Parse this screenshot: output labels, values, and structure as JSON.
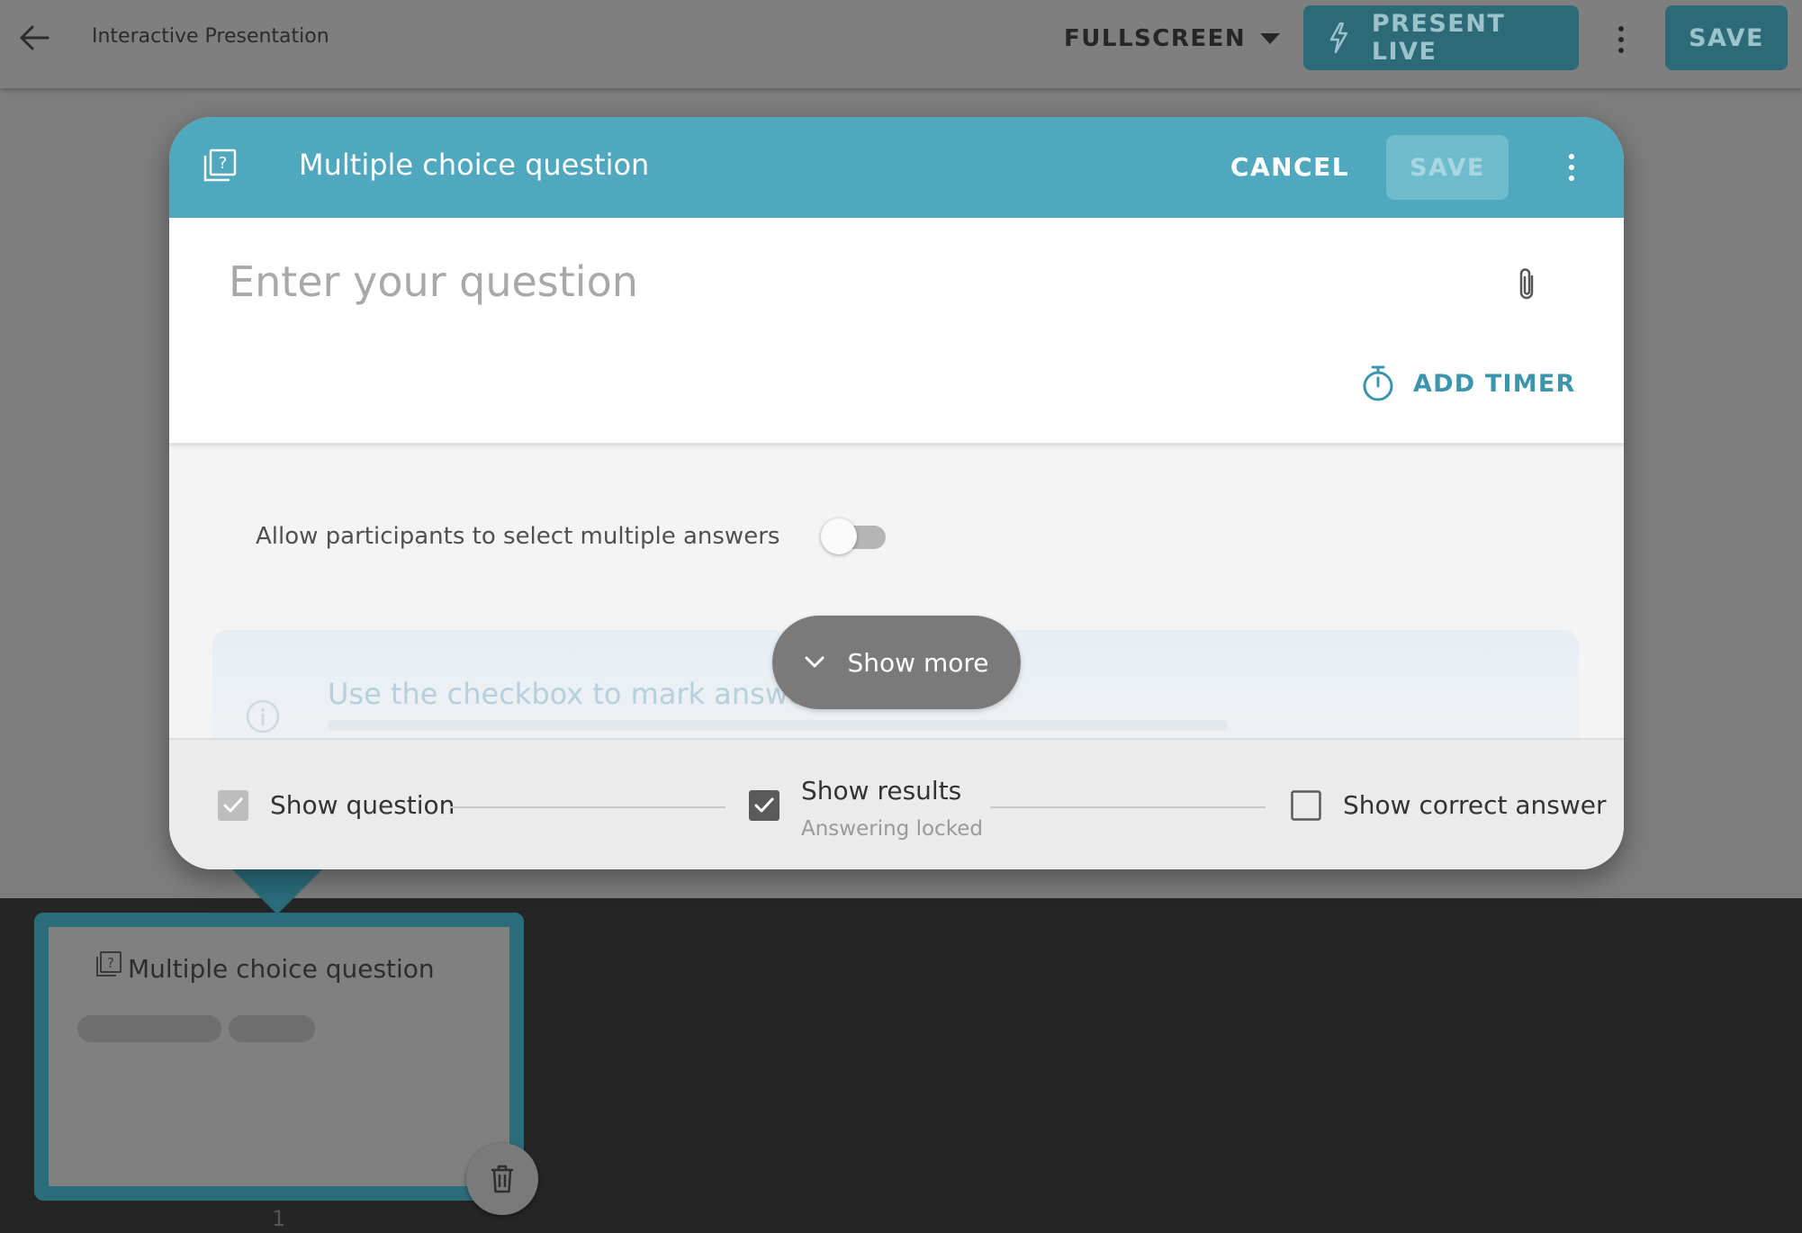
{
  "topbar": {
    "title": "Interactive Presentation",
    "view_mode": "FULLSCREEN",
    "present_label": "PRESENT LIVE",
    "save_label": "SAVE"
  },
  "modal": {
    "title": "Multiple choice question",
    "cancel_label": "CANCEL",
    "save_label": "SAVE",
    "question_placeholder": "Enter your question",
    "add_timer_label": "ADD TIMER",
    "multi_answer_label": "Allow participants to select multiple answers",
    "multi_answer_enabled": false,
    "info_text": "Use the checkbox to mark answers as correct",
    "show_more_label": "Show more",
    "steps": [
      {
        "label": "Show question",
        "checked": true,
        "disabled": true
      },
      {
        "label": "Show results",
        "sublabel": "Answering locked",
        "checked": true
      },
      {
        "label": "Show correct answer",
        "checked": false
      }
    ]
  },
  "slides": [
    {
      "title": "Multiple choice question",
      "number": "1"
    }
  ],
  "colors": {
    "accent": "#4fa8bd",
    "accent_dark": "#2b6c7b",
    "tray": "#252525"
  },
  "icons": {
    "back": "arrow-left-icon",
    "present": "lightning-icon",
    "question_type": "question-box-icon",
    "attach": "paperclip-icon",
    "timer": "stopwatch-icon",
    "info": "info-icon",
    "show_more": "chevron-down-icon",
    "delete": "trash-icon"
  }
}
